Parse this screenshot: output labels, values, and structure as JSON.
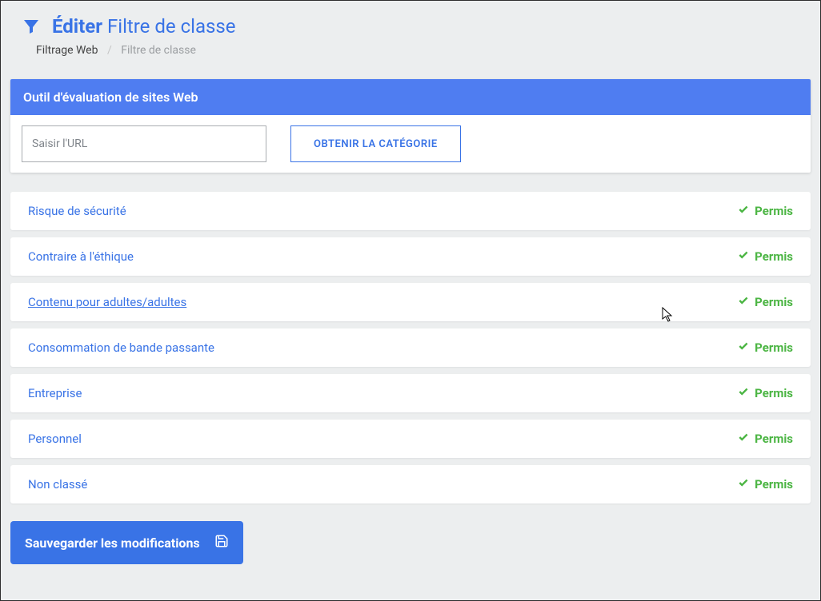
{
  "header": {
    "title_bold": "Éditer",
    "title_rest": "Filtre de classe"
  },
  "breadcrumb": {
    "level1": "Filtrage Web",
    "level2": "Filtre de classe"
  },
  "tool_card": {
    "header": "Outil d'évaluation de sites Web",
    "url_placeholder": "Saisir l'URL",
    "get_category_btn": "OBTENIR LA CATÉGORIE"
  },
  "status_permitted": "Permis",
  "categories": {
    "0": {
      "label": "Risque de sécurité"
    },
    "1": {
      "label": "Contraire à l'éthique"
    },
    "2": {
      "label": "Contenu pour adultes/adultes"
    },
    "3": {
      "label": "Consommation de bande passante"
    },
    "4": {
      "label": "Entreprise"
    },
    "5": {
      "label": "Personnel"
    },
    "6": {
      "label": "Non classé"
    }
  },
  "save_button": "Sauvegarder les modifications"
}
